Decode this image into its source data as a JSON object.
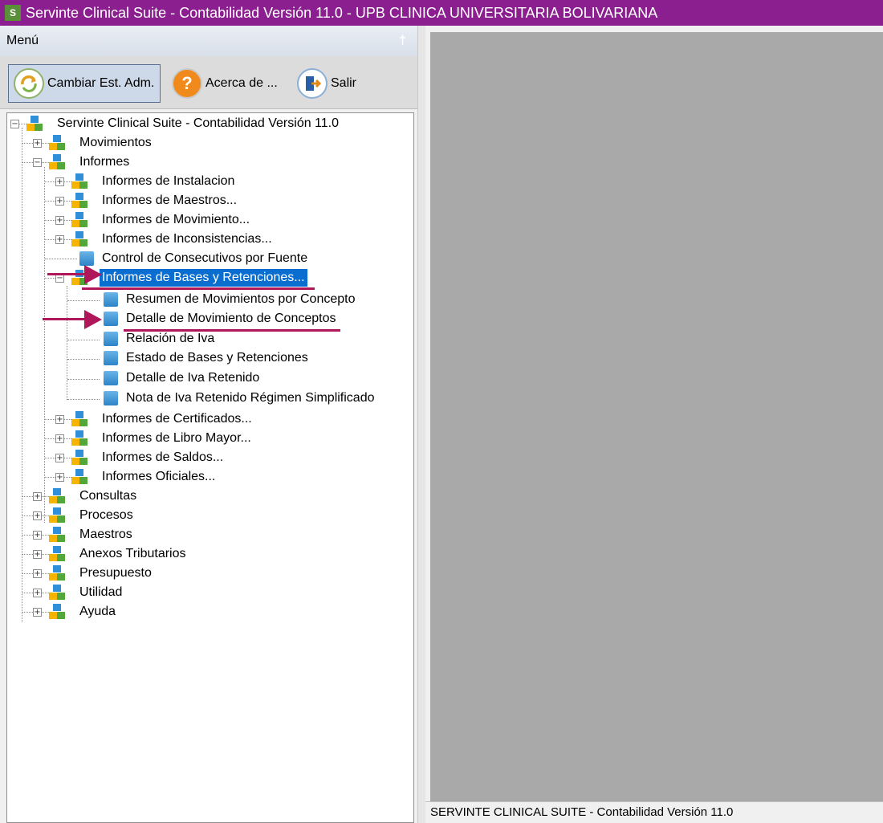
{
  "window": {
    "title": "Servinte Clinical Suite - Contabilidad Versión 11.0  - UPB  CLINICA UNIVERSITARIA BOLIVARIANA"
  },
  "menu": {
    "header": "Menú",
    "pin_glyph": "†"
  },
  "toolbar": {
    "cambiar": "Cambiar Est. Adm.",
    "acerca": "Acerca de ...",
    "salir": "Salir"
  },
  "tree": {
    "root": "Servinte Clinical Suite - Contabilidad Versión 11.0",
    "movimientos": "Movimientos",
    "informes": "Informes",
    "informes_items": [
      "Informes de Instalacion",
      "Informes de Maestros...",
      "Informes de Movimiento...",
      "Informes de Inconsistencias...",
      "Control de Consecutivos por Fuente",
      "Informes de Bases y Retenciones..."
    ],
    "bases_items": [
      "Resumen de Movimientos por Concepto",
      "Detalle de Movimiento de Conceptos",
      "Relación de Iva",
      "Estado de Bases y Retenciones",
      "Detalle de Iva Retenido",
      "Nota de Iva Retenido Régimen Simplificado"
    ],
    "informes_items2": [
      "Informes de Certificados...",
      "Informes de Libro Mayor...",
      "Informes de Saldos...",
      "Informes Oficiales..."
    ],
    "top_items": [
      "Consultas",
      "Procesos",
      "Maestros",
      "Anexos Tributarios",
      "Presupuesto",
      "Utilidad",
      "Ayuda"
    ]
  },
  "status": {
    "text": "SERVINTE CLINICAL SUITE - Contabilidad Versión 11.0"
  },
  "colors": {
    "titlebar": "#8b1f8f",
    "selection": "#0a6ed1",
    "annotation": "#b0175a",
    "workspace": "#a9a9a9"
  }
}
